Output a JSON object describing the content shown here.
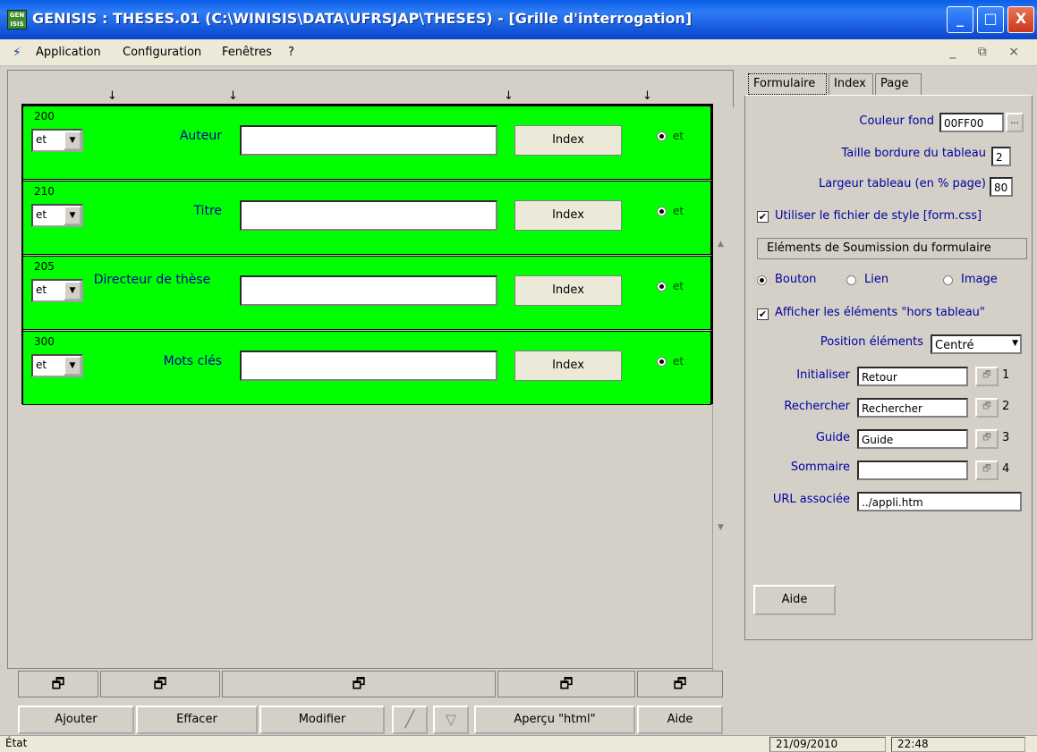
{
  "window": {
    "title": "GENISIS : THESES.01 (C:\\WINISIS\\DATA\\UFRSJAP\\THESES) - [Grille d'interrogation]",
    "minimize": "_",
    "maximize": "□",
    "close": "X"
  },
  "menu": {
    "items": [
      "Application",
      "Configuration",
      "Fenêtres",
      "?"
    ],
    "mdi": "_ ⧉ ×"
  },
  "rows": [
    {
      "tag": "200",
      "op": "et",
      "label": "Auteur",
      "value": "",
      "index": "Index",
      "radio": "et"
    },
    {
      "tag": "210",
      "op": "et",
      "label": "Titre",
      "value": "",
      "index": "Index",
      "radio": "et"
    },
    {
      "tag": "205",
      "op": "et",
      "label": "Directeur de thèse",
      "value": "",
      "index": "Index",
      "radio": "et"
    },
    {
      "tag": "300",
      "op": "et",
      "label": "Mots clés",
      "value": "",
      "index": "Index",
      "radio": "et"
    }
  ],
  "bottom_buttons": [
    "Ajouter",
    "Effacer",
    "Modifier",
    "Aperçu \"html\"",
    "Aide"
  ],
  "status": {
    "state": "État",
    "date": "21/09/2010",
    "time": "22:48"
  },
  "panel": {
    "tabs": [
      "Formulaire",
      "Index",
      "Page"
    ],
    "couleur_fond_label": "Couleur fond",
    "couleur_fond_value": "00FF00",
    "couleur_btn": "...",
    "taille_label": "Taille bordure du tableau",
    "taille_value": "2",
    "largeur_label": "Largeur tableau (en % page)",
    "largeur_value": "80",
    "style_label": "Utiliser le fichier de style [form.css]",
    "soumission_label": "Eléments de Soumission du formulaire",
    "radio_bouton": "Bouton",
    "radio_lien": "Lien",
    "radio_image": "Image",
    "hors_label": "Afficher les éléments \"hors tableau\"",
    "position_label": "Position éléments",
    "position_value": "Centré",
    "fields": [
      {
        "label": "Initialiser",
        "value": "Retour",
        "num": "1"
      },
      {
        "label": "Rechercher",
        "value": "Rechercher",
        "num": "2"
      },
      {
        "label": "Guide",
        "value": "Guide",
        "num": "3"
      },
      {
        "label": "Sommaire",
        "value": "",
        "num": "4"
      }
    ],
    "url_label": "URL associée",
    "url_value": "../appli.htm",
    "aide": "Aide"
  }
}
